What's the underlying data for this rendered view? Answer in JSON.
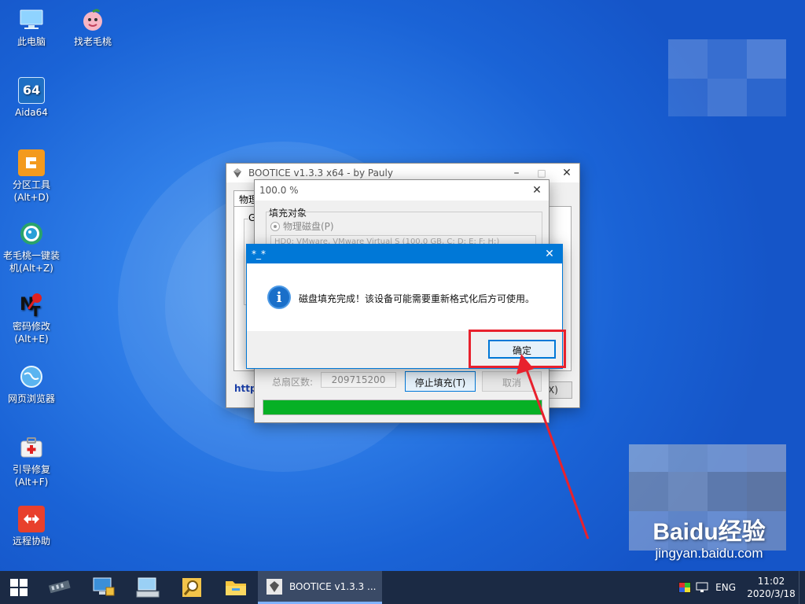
{
  "desktop": {
    "icons": [
      {
        "label": "此电脑",
        "icon": "this-pc-icon"
      },
      {
        "label": "找老毛桃",
        "icon": "peach-icon"
      },
      {
        "label": "Aida64",
        "icon": "aida64-icon",
        "glyph": "64"
      },
      {
        "label": "分区工具",
        "label2": "(Alt+D)",
        "icon": "partition-tool-icon"
      },
      {
        "label": "老毛桃一键装",
        "label2": "机(Alt+Z)",
        "icon": "one-key-install-icon"
      },
      {
        "label": "密码修改",
        "label2": "(Alt+E)",
        "icon": "password-change-icon"
      },
      {
        "label": "网页浏览器",
        "icon": "web-browser-icon"
      },
      {
        "label": "引导修复",
        "label2": "(Alt+F)",
        "icon": "boot-repair-icon"
      },
      {
        "label": "远程协助",
        "icon": "remote-assist-icon"
      }
    ]
  },
  "bootice": {
    "title": "BOOTICE v1.3.3 x64 - by Pauly",
    "tab": "物理",
    "group_letter": "G",
    "link_text": "http",
    "close_shortcut": "X)"
  },
  "progress": {
    "title": "100.0 %",
    "group_label": "填充对象",
    "radio_label": "物理磁盘(P)",
    "disk_select": "HD0: VMware, VMware Virtual S (100.0 GB, C: D: E: F: H:)",
    "total_sectors_label": "总扇区数:",
    "total_sectors_value": "209715200",
    "stop_button": "停止填充(T)",
    "cancel_button": "取消",
    "percent": 100
  },
  "message": {
    "title": "*_*",
    "text": "磁盘填充完成！该设备可能需要重新格式化后方可使用。",
    "ok_button": "确定"
  },
  "taskbar": {
    "task_label": "BOOTICE v1.3.3 ...",
    "lang": "ENG",
    "time": "11:02",
    "date": "2020/3/18"
  },
  "watermark": {
    "brand": "Baidu经验",
    "url": "jingyan.baidu.com"
  },
  "colors": {
    "accent": "#0078d7",
    "progress": "#06b025",
    "annotation": "#e8212d"
  }
}
